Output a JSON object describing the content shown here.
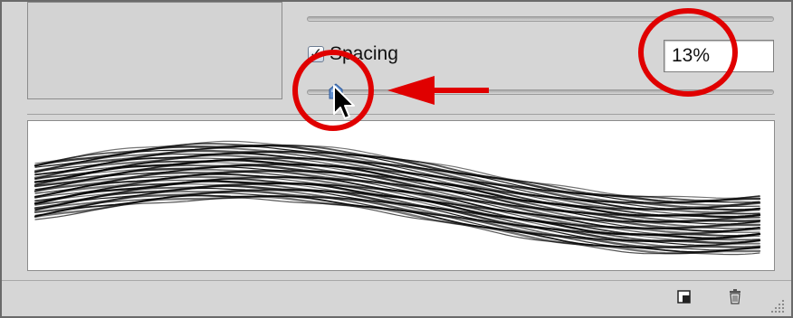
{
  "brush_panel": {
    "spacing": {
      "label": "Spacing",
      "checked": true,
      "check_glyph": "✓",
      "value": "13%",
      "slider_fraction": 0.07
    },
    "footer": {
      "icons": [
        "new-brush-icon",
        "trash-icon",
        "resize-grip-icon"
      ]
    }
  },
  "annotations": {
    "color": "#e00000",
    "shapes": [
      "circle-around-slider-thumb",
      "circle-around-value-field",
      "arrow-pointing-left"
    ]
  },
  "colors": {
    "panel_bg": "#d6d6d6",
    "preview_bg": "#ffffff",
    "stroke": "#000000",
    "annotation_red": "#e00000",
    "slider_thumb": "#5f8fd0"
  }
}
